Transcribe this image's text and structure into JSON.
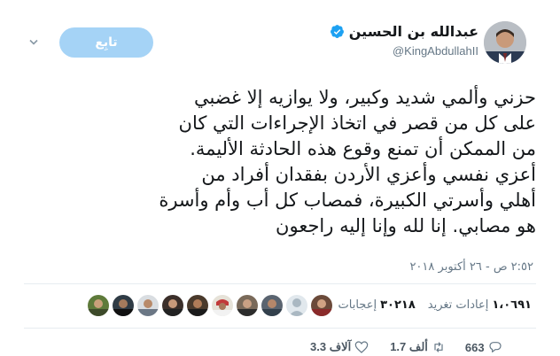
{
  "header": {
    "display_name": "عبدالله بن الحسين",
    "handle": "@KingAbdullahII",
    "follow_label": "تابِع"
  },
  "tweet": {
    "lines": [
      "حزني وألمي شديد وكبير، ولا يوازيه إلا غضبي",
      "على كل من قصر في اتخاذ الإجراءات التي كان",
      "من الممكن أن تمنع وقوع هذه الحادثة الأليمة.",
      "أعزي نفسي وأعزي الأردن بفقدان أفراد من",
      "أهلي وأسرتي الكبيرة، فمصاب كل أب وأم وأسرة",
      "هو مصابي. إنا لله وإنا إليه راجعون"
    ],
    "timestamp": "٢:٥٢ ص - ٢٦ أكتوبر ٢٠١٨"
  },
  "stats": {
    "retweets_count": "١،٠٦٩١",
    "retweets_label": "إعادات تغريد",
    "likes_count": "٣٠٢١٨",
    "likes_label": "إعجابات"
  },
  "actions": {
    "replies": "663",
    "retweets": "1.7 ألف",
    "likes": "3.3 آلاف"
  },
  "colors": {
    "accent": "#1da1f2",
    "follow_button": "#a5d3f6",
    "muted": "#657786",
    "divider": "#e6ecf0"
  },
  "icons": [
    "verified-badge-icon",
    "chevron-down-icon",
    "reply-icon",
    "retweet-icon",
    "like-icon"
  ]
}
